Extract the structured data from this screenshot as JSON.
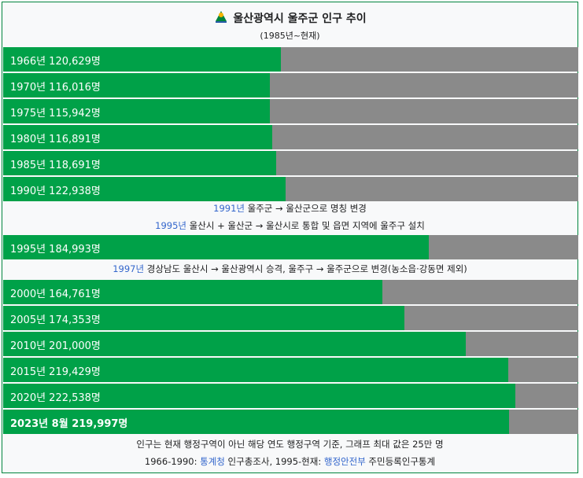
{
  "header": {
    "title": "울산광역시 울주군 인구 추이",
    "subtitle": "(1985년~현재)",
    "emblem_icon": "ulsan-emblem-icon"
  },
  "chart_data": {
    "type": "bar",
    "orientation": "horizontal",
    "xlim": [
      0,
      250000
    ],
    "colors": {
      "bar": "#00a148",
      "track": "#8a8a8a",
      "link": "#3366cc"
    },
    "bars": [
      {
        "label": "1966년 120,629명",
        "value": 120629,
        "bold": false
      },
      {
        "label": "1970년 116,016명",
        "value": 116016,
        "bold": false
      },
      {
        "label": "1975년 115,942명",
        "value": 115942,
        "bold": false
      },
      {
        "label": "1980년 116,891명",
        "value": 116891,
        "bold": false
      },
      {
        "label": "1985년 118,691명",
        "value": 118691,
        "bold": false
      },
      {
        "label": "1990년 122,938명",
        "value": 122938,
        "bold": false
      },
      {
        "label": "1995년 184,993명",
        "value": 184993,
        "bold": false
      },
      {
        "label": "2000년 164,761명",
        "value": 164761,
        "bold": false
      },
      {
        "label": "2005년 174,353명",
        "value": 174353,
        "bold": false
      },
      {
        "label": "2010년 201,000명",
        "value": 201000,
        "bold": false
      },
      {
        "label": "2015년 219,429명",
        "value": 219429,
        "bold": false
      },
      {
        "label": "2020년 222,538명",
        "value": 222538,
        "bold": false
      },
      {
        "label": "2023년 8월 219,997명",
        "value": 219997,
        "bold": true
      }
    ]
  },
  "notes": [
    {
      "link": "1991년",
      "text": " 울주군 → 울산군으로 명칭 변경"
    },
    {
      "link": "1995년",
      "text": " 울산시 + 울산군 → 울산시로 통합 및 읍면 지역에 울주구 설치"
    },
    {
      "link": "1997년",
      "text": " 경상남도 울산시 → 울산광역시 승격, 울주구 → 울주군으로 변경(농소읍·강동면 제외)"
    }
  ],
  "footer": {
    "line1": "인구는 현재 행정구역이 아닌 해당 연도 행정구역 기준, 그래프 최대 값은 25만 명",
    "line2_prefix": "1966-1990: ",
    "line2_link1": "통계청",
    "line2_mid": " 인구총조사, 1995-현재: ",
    "line2_link2": "행정안전부",
    "line2_suffix": " 주민등록인구통계"
  }
}
